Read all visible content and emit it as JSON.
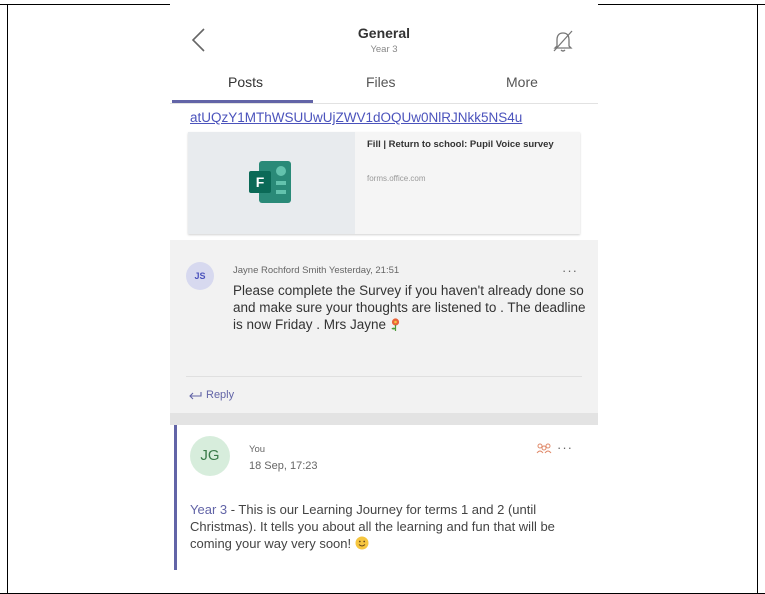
{
  "header": {
    "title": "General",
    "subtitle": "Year 3",
    "tabs": [
      {
        "label": "Posts",
        "active": true
      },
      {
        "label": "Files",
        "active": false
      },
      {
        "label": "More",
        "active": false
      }
    ],
    "icons": {
      "back": "chevron-left-icon",
      "notifications": "bell-off-icon"
    }
  },
  "link_text": "atUQzY1MThWSUUwUjZWV1dOQUw0NlRJNkk5NS4u",
  "link_card": {
    "title": "Fill | Return to school: Pupil Voice survey",
    "domain": "forms.office.com",
    "icon": "microsoft-forms-icon"
  },
  "reply_message": {
    "avatar_initials": "JS",
    "meta": "Jayne Rochford Smith Yesterday, 21:51",
    "text": "Please complete the Survey if you haven't already done so and make sure your thoughts are listened to . The deadline is now Friday . Mrs Jayne",
    "emoji": "flower-emoji",
    "more": "···"
  },
  "reply_action": {
    "label": "Reply",
    "icon": "reply-arrow-icon"
  },
  "post": {
    "avatar_initials": "JG",
    "author": "You",
    "time": "18 Sep, 17:23",
    "channel_mention": "Year 3",
    "text": " - This is our Learning Journey for terms 1 and 2 (until Christmas). It tells you about all the learning and fun that will be coming your way very soon!",
    "emoji": "smile-emoji",
    "more": "···",
    "group_icon": "group-icon"
  },
  "colors": {
    "accent": "#6264a7",
    "link": "#4b53bc",
    "thread_bg": "#f2f2f2",
    "avatar_js_bg": "#d7d9ef",
    "avatar_jg_bg": "#d7eddc"
  }
}
